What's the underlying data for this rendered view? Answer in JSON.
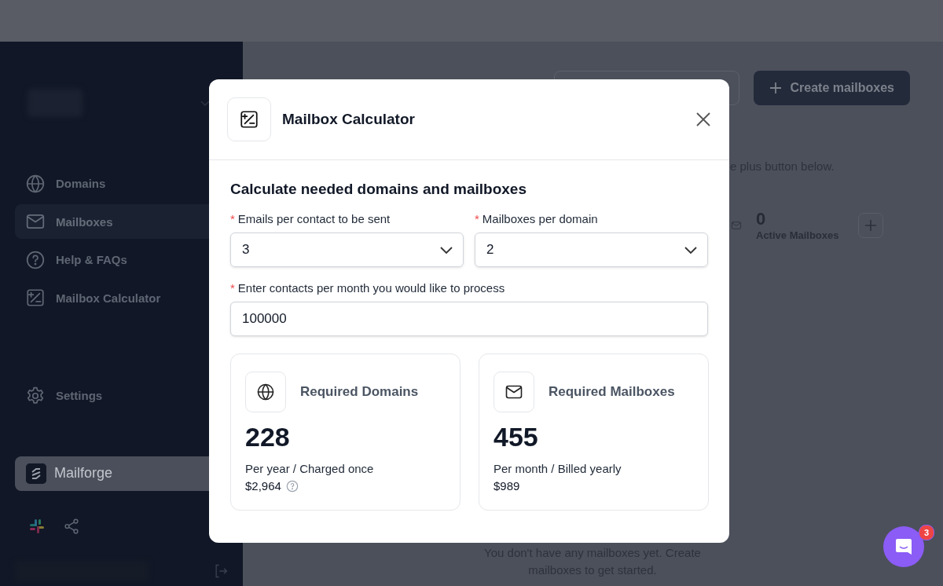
{
  "sidebar": {
    "items": [
      {
        "label": "Domains",
        "kind": "globe",
        "selected": false
      },
      {
        "label": "Mailboxes",
        "kind": "mail",
        "selected": true
      },
      {
        "label": "Help & FAQs",
        "kind": "help",
        "selected": false
      },
      {
        "label": "Mailbox Calculator",
        "kind": "calculator",
        "selected": false
      }
    ],
    "settings": {
      "label": "Settings",
      "kind": "settings",
      "selected": false
    },
    "workspace": {
      "name": "Mailforge"
    }
  },
  "main": {
    "create_button": "Create mailboxes",
    "hint": "e plus button below.",
    "stats": [
      {
        "value": "0",
        "label": "Active Mailboxes"
      }
    ],
    "empty_message": "You don't have any mailboxes yet. Create mailboxes to get started."
  },
  "modal": {
    "title": "Mailbox Calculator",
    "heading": "Calculate needed domains and mailboxes",
    "fields": [
      {
        "kind": "select",
        "required_mark": "*",
        "label": "Emails per contact to be sent",
        "value": "3"
      },
      {
        "kind": "select",
        "required_mark": "*",
        "label": "Mailboxes per domain",
        "value": "2"
      },
      {
        "kind": "input",
        "required_mark": "*",
        "label": "Enter contacts per month you would like to process",
        "value": "100000"
      }
    ],
    "results": [
      {
        "kind": "globe",
        "title": "Required Domains",
        "value": "228",
        "note": "Per year / Charged once",
        "price": "$2,964",
        "info": true
      },
      {
        "kind": "mail",
        "title": "Required Mailboxes",
        "value": "455",
        "note": "Per month / Billed yearly",
        "price": "$989",
        "info": false
      }
    ]
  },
  "chat": {
    "badge": "3"
  }
}
